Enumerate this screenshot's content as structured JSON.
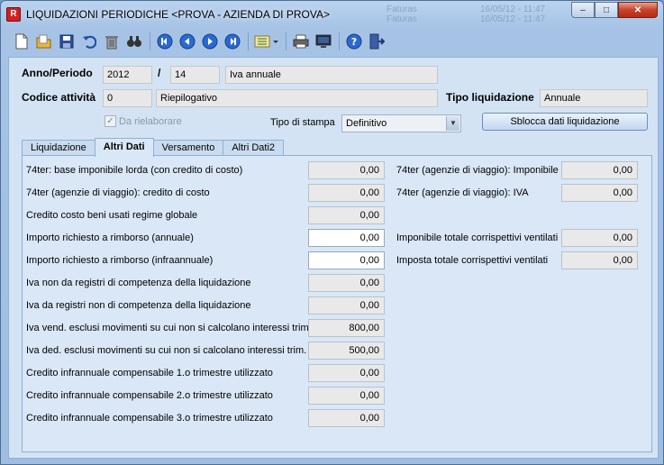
{
  "window": {
    "title": "LIQUIDAZIONI PERIODICHE <PROVA - AZIENDA DI PROVA>",
    "app_icon": "R",
    "background_rows": [
      {
        "label": "Faturas",
        "date": "16/05/12 - 11:47"
      },
      {
        "label": "Faturas",
        "date": "16/05/12 - 11:47"
      }
    ],
    "controls": {
      "minimize": "–",
      "maximize": "□",
      "close": "✕"
    }
  },
  "toolbar": {
    "icons": [
      "new-document-icon",
      "open-folder-icon",
      "save-icon",
      "undo-icon",
      "delete-icon",
      "search-icon",
      "first-record-icon",
      "previous-record-icon",
      "next-record-icon",
      "last-record-icon",
      "list-view-icon",
      "print-icon",
      "preview-monitor-icon",
      "help-icon",
      "exit-icon"
    ]
  },
  "header": {
    "anno_periodo_label": "Anno/Periodo",
    "anno": "2012",
    "slash": "/",
    "periodo": "14",
    "periodo_desc": "Iva annuale",
    "codice_attivita_label": "Codice attività",
    "codice": "0",
    "codice_desc": "Riepilogativo",
    "tipo_liquidazione_label": "Tipo liquidazione",
    "tipo_liquidazione": "Annuale",
    "da_rielaborare_label": "Da rielaborare",
    "da_rielaborare_checked": true,
    "tipo_stampa_label": "Tipo di stampa",
    "tipo_stampa": "Definitivo",
    "sblocca_label": "Sblocca dati liquidazione"
  },
  "tabs": [
    {
      "label": "Liquidazione",
      "active": false
    },
    {
      "label": "Altri Dati",
      "active": true
    },
    {
      "label": "Versamento",
      "active": false
    },
    {
      "label": "Altri Dati2",
      "active": false
    }
  ],
  "left_fields": [
    {
      "label": "74ter: base imponibile lorda (con credito di costo)",
      "value": "0,00",
      "editable": false
    },
    {
      "label": "74ter (agenzie di viaggio): credito di costo",
      "value": "0,00",
      "editable": false
    },
    {
      "label": "Credito costo beni usati regime globale",
      "value": "0,00",
      "editable": false
    },
    {
      "label": "Importo richiesto a rimborso (annuale)",
      "value": "0,00",
      "editable": true
    },
    {
      "label": "Importo richiesto a rimborso (infraannuale)",
      "value": "0,00",
      "editable": true
    },
    {
      "label": "Iva non da  registri  di competenza della liquidazione",
      "value": "0,00",
      "editable": false
    },
    {
      "label": "Iva da registri non di competenza della liquidazione",
      "value": "0,00",
      "editable": false
    },
    {
      "label": "Iva vend. esclusi movimenti su cui non si calcolano interessi trim.",
      "value": "800,00",
      "editable": false
    },
    {
      "label": "Iva ded. esclusi movimenti su cui non si calcolano interessi trim.",
      "value": "500,00",
      "editable": false
    },
    {
      "label": "Credito  infrannuale compensabile 1.o trimestre utilizzato",
      "value": "0,00",
      "editable": false
    },
    {
      "label": "Credito  infrannuale compensabile 2.o trimestre utilizzato",
      "value": "0,00",
      "editable": false
    },
    {
      "label": "Credito  infrannuale compensabile 3.o trimestre utilizzato",
      "value": "0,00",
      "editable": false
    }
  ],
  "right_fields": [
    {
      "label": "74ter (agenzie di viaggio): Imponibile",
      "value": "0,00"
    },
    {
      "label": "74ter (agenzie di viaggio): IVA",
      "value": "0,00"
    },
    {
      "label": "Imponibile totale corrispettivi ventilati",
      "value": "0,00"
    },
    {
      "label": "Imposta totale corrispettivi ventilati",
      "value": "0,00"
    }
  ]
}
